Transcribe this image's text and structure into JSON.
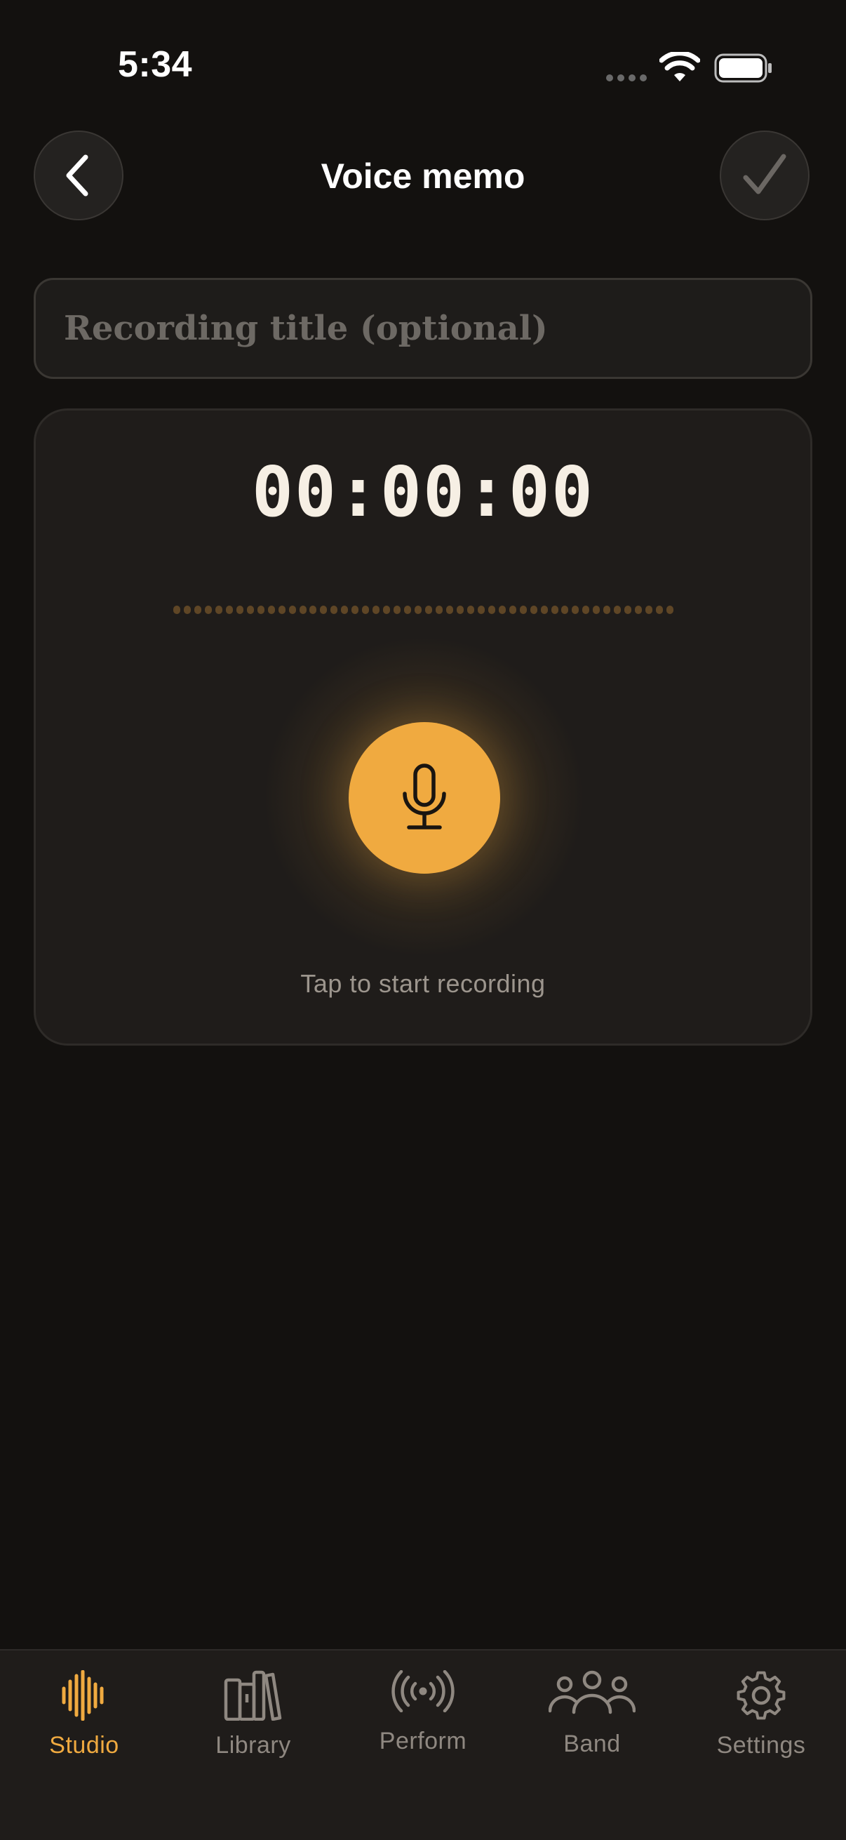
{
  "status_bar": {
    "time": "5:34"
  },
  "header": {
    "title": "Voice memo",
    "back_icon": "chevron-left-icon",
    "confirm_icon": "checkmark-icon"
  },
  "title_input": {
    "placeholder": "Recording title (optional)",
    "value": ""
  },
  "recorder": {
    "timer": "00:00:00",
    "hint": "Tap to start recording",
    "mic_icon": "microphone-icon",
    "accent_color": "#f0aa40"
  },
  "tab_bar": {
    "tabs": [
      {
        "label": "Studio",
        "icon": "waveform-icon",
        "active": true
      },
      {
        "label": "Library",
        "icon": "books-icon",
        "active": false
      },
      {
        "label": "Perform",
        "icon": "broadcast-icon",
        "active": false
      },
      {
        "label": "Band",
        "icon": "people-icon",
        "active": false
      },
      {
        "label": "Settings",
        "icon": "gear-icon",
        "active": false
      }
    ]
  }
}
